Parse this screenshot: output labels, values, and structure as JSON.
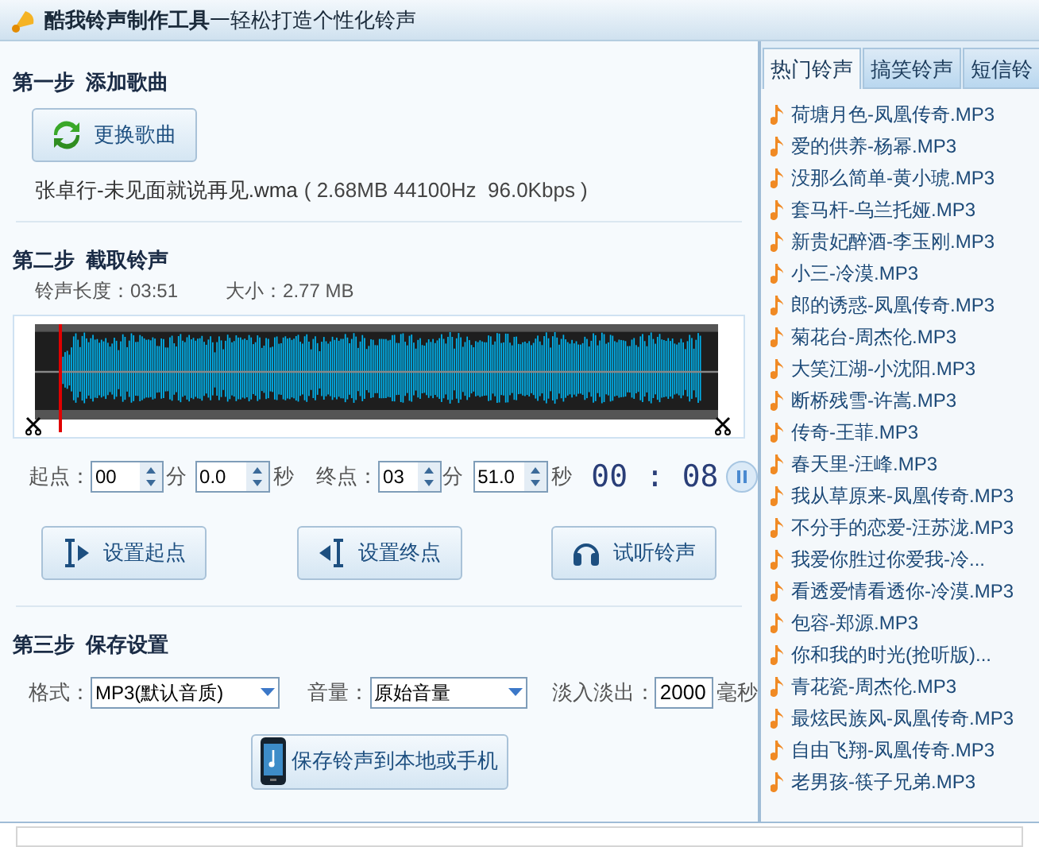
{
  "window": {
    "title_bold": "酷我铃声制作工具",
    "title_rest": "一轻松打造个性化铃声"
  },
  "step1": {
    "heading": "第一步  添加歌曲",
    "button": "更换歌曲",
    "file_name": "张卓行-未见面就说再见.wma",
    "file_info": "( 2.68MB 44100Hz  96.0Kbps )"
  },
  "step2": {
    "heading": "第二步  截取铃声",
    "length_label": "铃声长度：",
    "length": "03:51",
    "size_label": "大小：",
    "size": "2.77 MB",
    "playhead": {
      "level": 0.035
    },
    "start_label": "起点：",
    "start_min": "00",
    "min_unit_1": "分",
    "start_sec": "0.0",
    "sec_unit_1": "秒",
    "end_label": "终点：",
    "end_min": "03",
    "min_unit_2": "分",
    "end_sec": "51.0",
    "sec_unit_2": "秒",
    "timer_min": "00",
    "timer_sep": ":",
    "timer_sec": "08",
    "playing": true,
    "buttons": [
      {
        "kind": "start",
        "label": "设置起点"
      },
      {
        "kind": "end",
        "label": "设置终点"
      },
      {
        "kind": "listen",
        "label": "试听铃声"
      }
    ]
  },
  "step3": {
    "heading": "第三步  保存设置",
    "format_label": "格式：",
    "format": "MP3(默认音质)",
    "volume_label": "音量：",
    "volume": "原始音量",
    "fade_label": "淡入淡出：",
    "fade": "2000",
    "fade_unit": "毫秒",
    "save_button": "保存铃声到本地或手机"
  },
  "sidebar": {
    "tabs": [
      {
        "label": "热门铃声",
        "selected": true
      },
      {
        "label": "搞笑铃声",
        "selected": false
      },
      {
        "label": "短信铃",
        "selected": false
      }
    ],
    "items": [
      "荷塘月色-凤凰传奇.MP3",
      "爱的供养-杨幂.MP3",
      "没那么简单-黄小琥.MP3",
      "套马杆-乌兰托娅.MP3",
      "新贵妃醉酒-李玉刚.MP3",
      "小三-冷漠.MP3",
      "郎的诱惑-凤凰传奇.MP3",
      "菊花台-周杰伦.MP3",
      "大笑江湖-小沈阳.MP3",
      "断桥残雪-许嵩.MP3",
      "传奇-王菲.MP3",
      "春天里-汪峰.MP3",
      "我从草原来-凤凰传奇.MP3",
      "不分手的恋爱-汪苏泷.MP3",
      "我爱你胜过你爱我-冷...",
      "看透爱情看透你-冷漠.MP3",
      "包容-郑源.MP3",
      "你和我的时光(抢听版)...",
      "青花瓷-周杰伦.MP3",
      "最炫民族风-凤凰传奇.MP3",
      "自由飞翔-凤凰传奇.MP3",
      "老男孩-筷子兄弟.MP3"
    ]
  }
}
